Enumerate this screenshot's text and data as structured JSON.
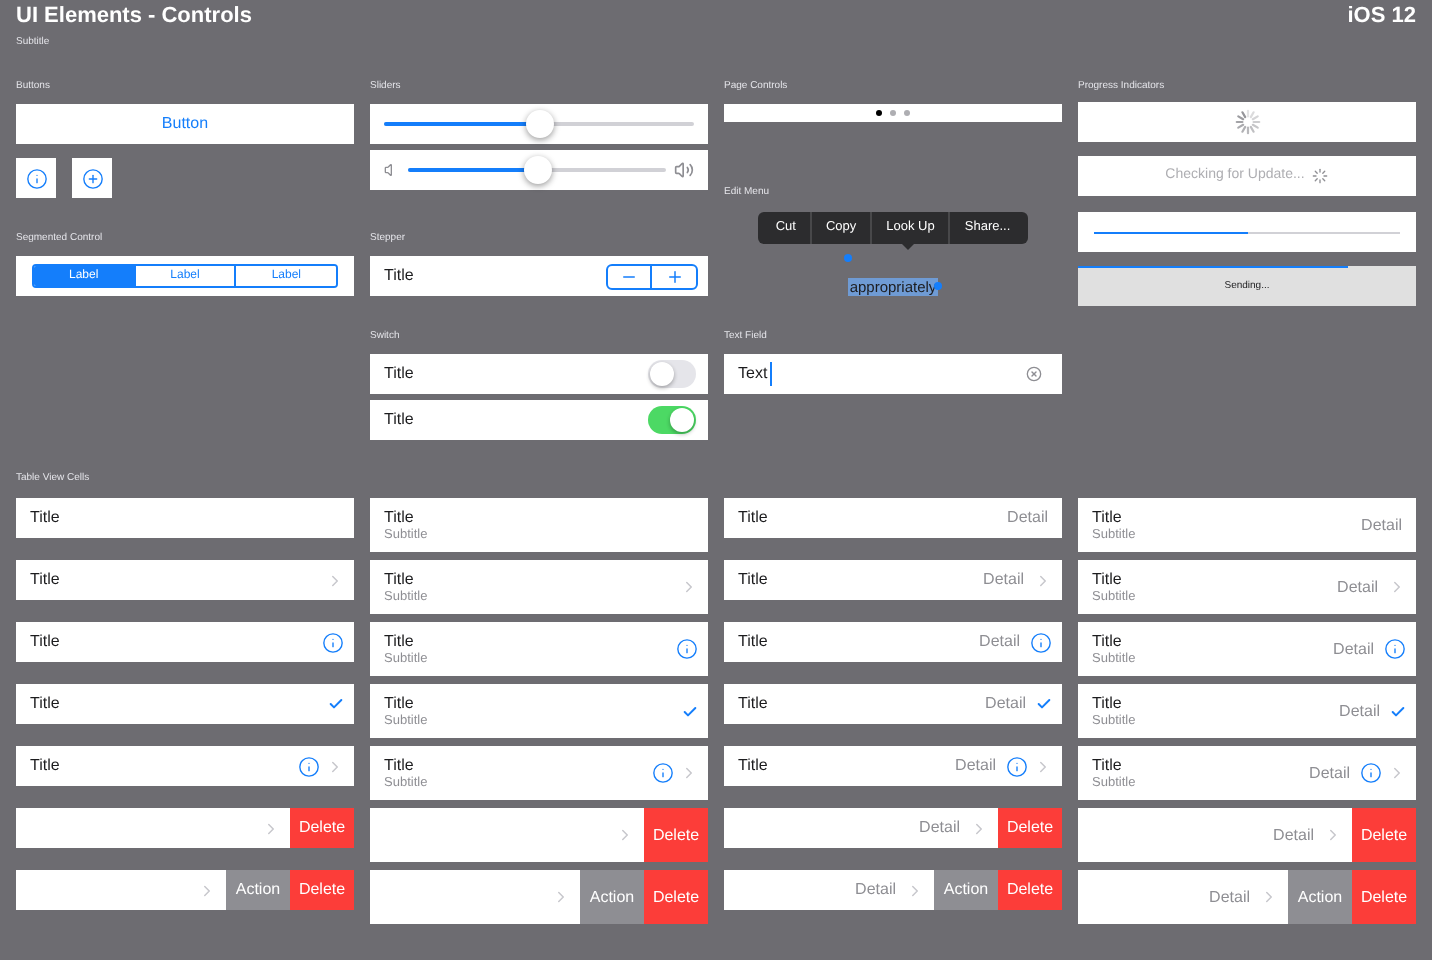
{
  "header": {
    "title": "UI Elements - Controls",
    "subtitle": "Subtitle",
    "platform": "iOS 12"
  },
  "buttons": {
    "label": "Buttons",
    "button": "Button"
  },
  "segmented_control": {
    "label": "Segmented Control",
    "segments": [
      {
        "label": "Label",
        "selected": true
      },
      {
        "label": "Label",
        "selected": false
      },
      {
        "label": "Label",
        "selected": false
      }
    ]
  },
  "sliders": {
    "label": "Sliders",
    "items": [
      {
        "kind": "plain",
        "level": 0.5
      },
      {
        "kind": "volume",
        "level": 0.5
      }
    ]
  },
  "stepper": {
    "label": "Stepper",
    "title": "Title"
  },
  "switch": {
    "label": "Switch",
    "items": [
      {
        "title": "Title",
        "on": false
      },
      {
        "title": "Title",
        "on": true
      }
    ]
  },
  "page_controls": {
    "label": "Page Controls",
    "dots": [
      {
        "selected": true
      },
      {
        "selected": false
      },
      {
        "selected": false
      }
    ]
  },
  "edit_menu": {
    "label": "Edit Menu",
    "items": [
      "Cut",
      "Copy",
      "Look Up",
      "Share..."
    ],
    "selected_text": "appropriately"
  },
  "text_field": {
    "label": "Text Field",
    "value": "Text"
  },
  "progress_indicators": {
    "label": "Progress Indicators",
    "status": "Checking for Update...",
    "progress": {
      "level": 0.5
    },
    "sending": {
      "text": "Sending...",
      "level": 0.8
    }
  },
  "table_view_cells": {
    "label": "Table View Cells",
    "columns": [
      {
        "cells": [
          {
            "title": "Title",
            "kind": "plain"
          },
          {
            "title": "Title",
            "kind": "chevron"
          },
          {
            "title": "Title",
            "kind": "info"
          },
          {
            "title": "Title",
            "kind": "check"
          },
          {
            "title": "Title",
            "kind": "info_chevron"
          },
          {
            "kind": "chevron",
            "actions": [
              {
                "label": "Delete",
                "kind": "delete"
              }
            ]
          },
          {
            "kind": "chevron",
            "actions": [
              {
                "label": "Action",
                "kind": "action"
              },
              {
                "label": "Delete",
                "kind": "delete"
              }
            ]
          }
        ]
      },
      {
        "cells": [
          {
            "title": "Title",
            "subtitle": "Subtitle",
            "kind": "plain"
          },
          {
            "title": "Title",
            "subtitle": "Subtitle",
            "kind": "chevron"
          },
          {
            "title": "Title",
            "subtitle": "Subtitle",
            "kind": "info"
          },
          {
            "title": "Title",
            "subtitle": "Subtitle",
            "kind": "check"
          },
          {
            "title": "Title",
            "subtitle": "Subtitle",
            "kind": "info_chevron"
          },
          {
            "kind": "chevron",
            "actions": [
              {
                "label": "Delete",
                "kind": "delete"
              }
            ]
          },
          {
            "kind": "chevron",
            "actions": [
              {
                "label": "Action",
                "kind": "action"
              },
              {
                "label": "Delete",
                "kind": "delete"
              }
            ]
          }
        ]
      },
      {
        "cells": [
          {
            "title": "Title",
            "detail": "Detail",
            "kind": "plain"
          },
          {
            "title": "Title",
            "detail": "Detail",
            "kind": "chevron"
          },
          {
            "title": "Title",
            "detail": "Detail",
            "kind": "info"
          },
          {
            "title": "Title",
            "detail": "Detail",
            "kind": "check"
          },
          {
            "title": "Title",
            "detail": "Detail",
            "kind": "info_chevron"
          },
          {
            "detail": "Detail",
            "kind": "chevron",
            "actions": [
              {
                "label": "Delete",
                "kind": "delete"
              }
            ]
          },
          {
            "detail": "Detail",
            "kind": "chevron",
            "actions": [
              {
                "label": "Action",
                "kind": "action"
              },
              {
                "label": "Delete",
                "kind": "delete"
              }
            ]
          }
        ]
      },
      {
        "cells": [
          {
            "title": "Title",
            "subtitle": "Subtitle",
            "detail": "Detail",
            "kind": "plain"
          },
          {
            "title": "Title",
            "subtitle": "Subtitle",
            "detail": "Detail",
            "kind": "chevron"
          },
          {
            "title": "Title",
            "subtitle": "Subtitle",
            "detail": "Detail",
            "kind": "info"
          },
          {
            "title": "Title",
            "subtitle": "Subtitle",
            "detail": "Detail",
            "kind": "check"
          },
          {
            "title": "Title",
            "subtitle": "Subtitle",
            "detail": "Detail",
            "kind": "info_chevron"
          },
          {
            "detail": "Detail",
            "kind": "chevron",
            "actions": [
              {
                "label": "Delete",
                "kind": "delete"
              }
            ]
          },
          {
            "detail": "Detail",
            "kind": "chevron",
            "actions": [
              {
                "label": "Action",
                "kind": "action"
              },
              {
                "label": "Delete",
                "kind": "delete"
              }
            ]
          }
        ]
      }
    ]
  }
}
